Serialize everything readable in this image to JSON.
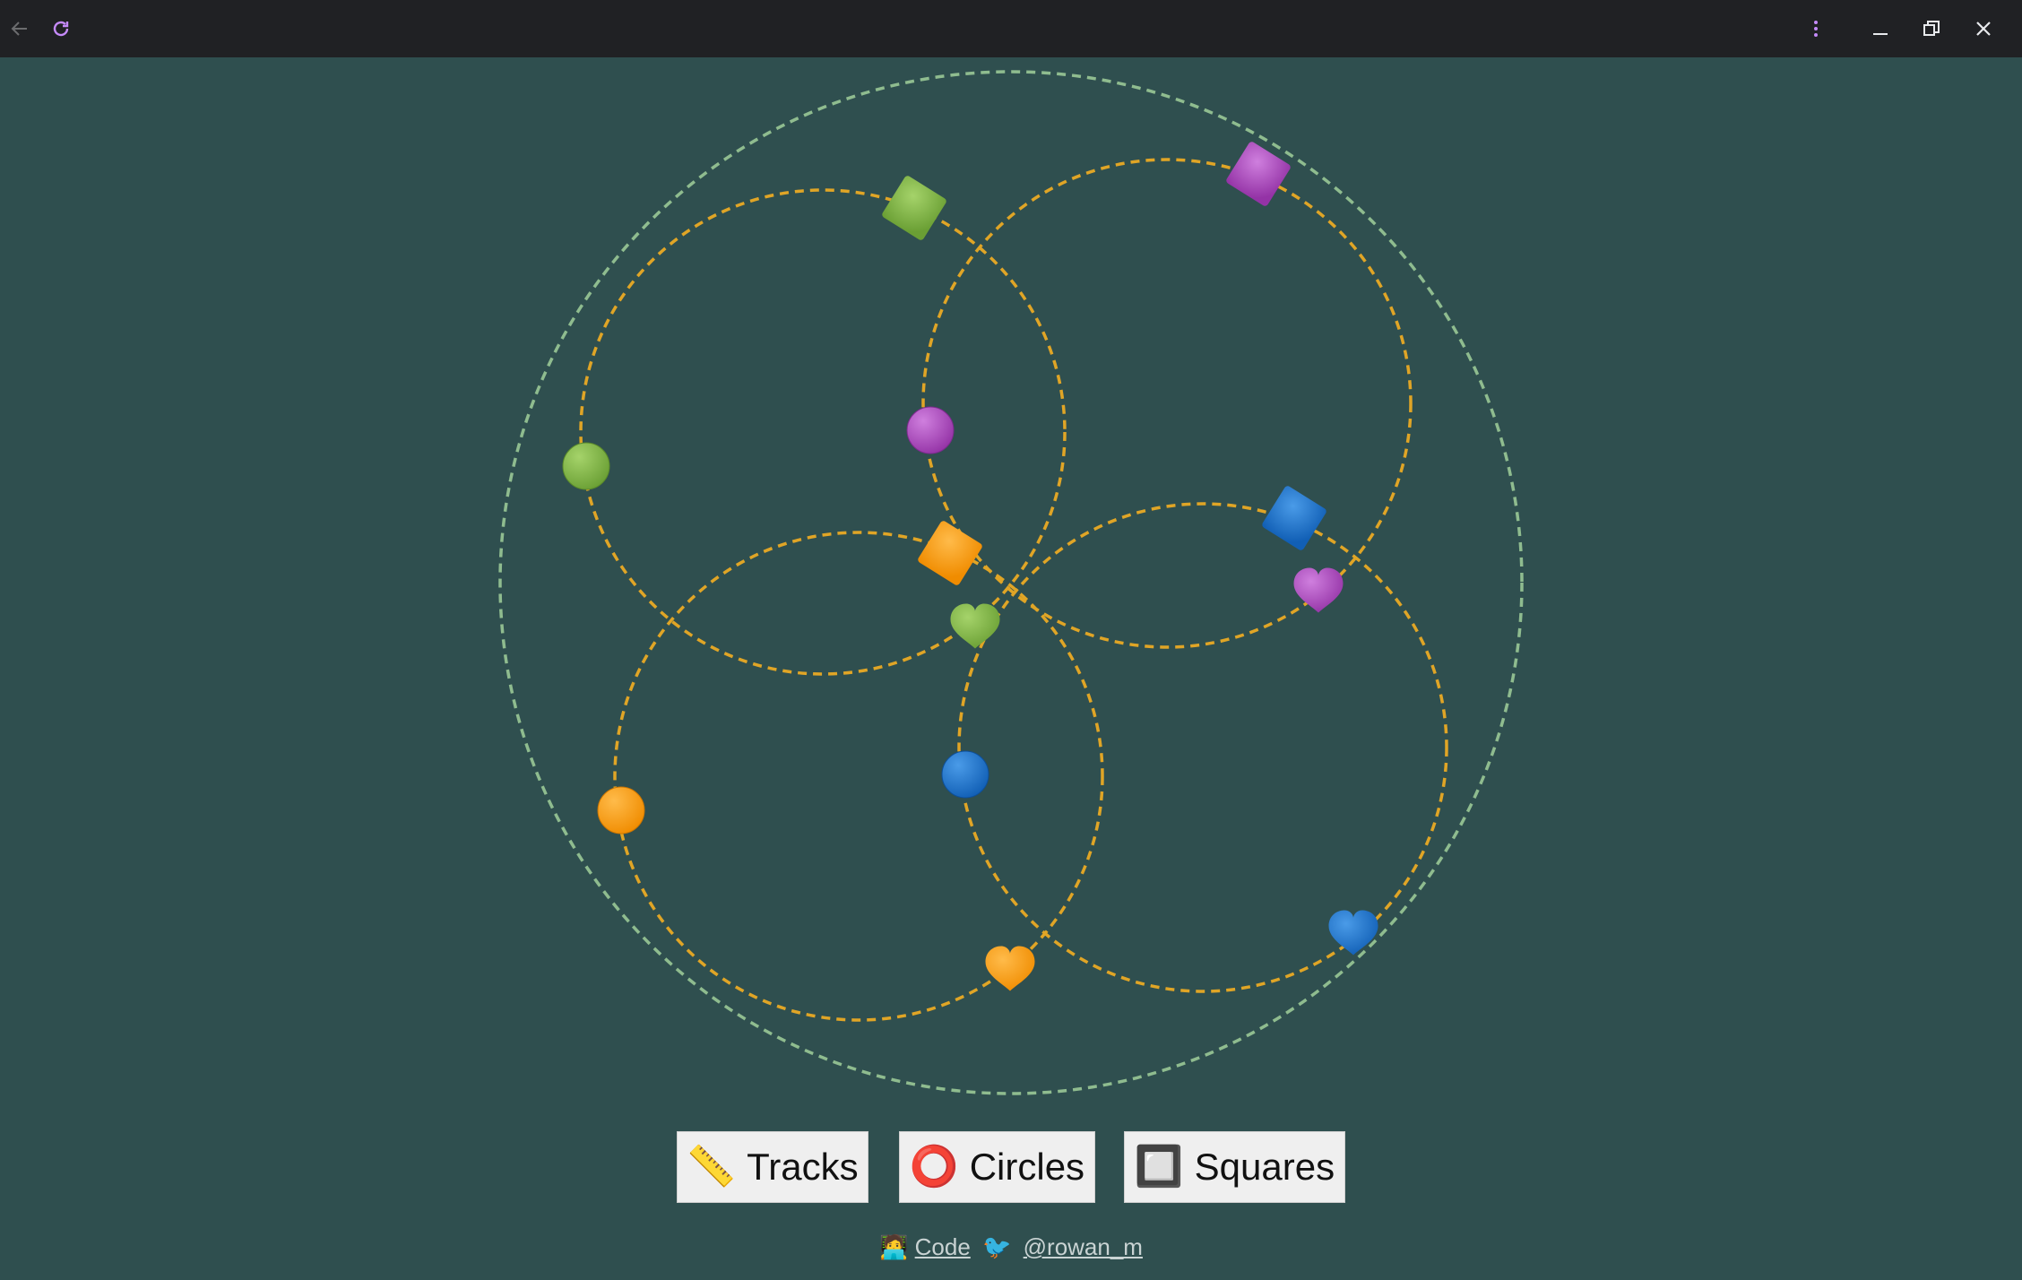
{
  "window": {
    "icons": {
      "back": "arrow-left-icon",
      "reload": "reload-icon",
      "menu": "kebab-menu-icon",
      "minimize": "minimize-icon",
      "restore": "restore-icon",
      "close": "close-icon"
    },
    "colors": {
      "titlebar": "#202124",
      "reload": "#c58af9",
      "icon": "#e8eaed",
      "disabled": "#6b6c6e"
    }
  },
  "scene": {
    "background": "#2f4f4f",
    "outer_track_color": "#8fbc8f",
    "inner_track_color": "#e0a526",
    "shape_colors": {
      "green": "#7cb342",
      "purple": "#ab47bc",
      "orange": "#ff9800",
      "blue": "#1976d2"
    }
  },
  "buttons": [
    {
      "emoji": "📏",
      "label": "Tracks"
    },
    {
      "emoji": "⭕",
      "label": "Circles"
    },
    {
      "emoji": "🔲",
      "label": "Squares"
    }
  ],
  "footer": {
    "code_emoji": "🧑‍💻",
    "code_label": "Code",
    "bird_emoji": "🐦",
    "handle_label": "@rowan_m"
  }
}
